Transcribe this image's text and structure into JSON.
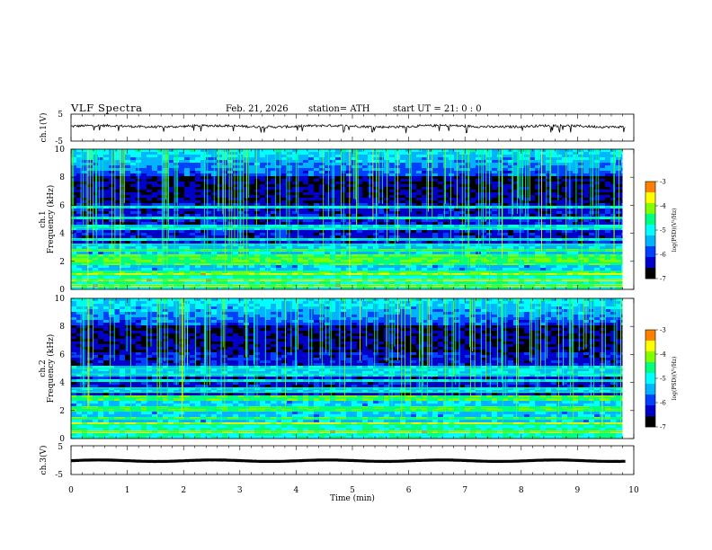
{
  "header": {
    "title": "VLF  Spectra",
    "date": "Feb. 21, 2026",
    "station": "station= ATH",
    "start_ut": "start  UT  =   21: 0   : 0"
  },
  "chart_data": [
    {
      "type": "line",
      "panel": "ch1-voltage",
      "ylabel": "ch.1(V)",
      "ylim": [
        -5,
        5
      ],
      "yticks": [
        "5",
        "-5"
      ],
      "xlim": [
        0,
        10
      ],
      "approx_level": 0.5,
      "noise_spikes": "frequent downward spikes to about -1.5 V"
    },
    {
      "type": "heatmap",
      "panel": "ch1-spectrogram",
      "ylabel_line1": "ch.1",
      "ylabel_line2": "Frequency (kHz)",
      "ylim": [
        0,
        10
      ],
      "yticks": [
        "0",
        "2",
        "4",
        "6",
        "8",
        "10"
      ],
      "xlim": [
        0,
        10
      ],
      "data_end_min": 9.8,
      "bands_khz": [
        0.3,
        0.7,
        1.0,
        1.3,
        1.9,
        2.3,
        2.8,
        3.2,
        3.6,
        4.4,
        5.1,
        5.9
      ],
      "sferic_bursts": "dense vertical impulsive lines across 0.5–10 kHz",
      "colorbar": {
        "label": "log(PSD)(V²/Hz)",
        "ticks": [
          "-3",
          "-4",
          "-5",
          "-6",
          "-7"
        ],
        "range": [
          -7,
          -3
        ]
      }
    },
    {
      "type": "heatmap",
      "panel": "ch2-spectrogram",
      "ylabel_line1": "ch.2",
      "ylabel_line2": "Frequency (kHz)",
      "ylim": [
        0,
        10
      ],
      "yticks": [
        "0",
        "2",
        "4",
        "6",
        "8",
        "10"
      ],
      "xlim": [
        0,
        10
      ],
      "data_end_min": 9.8,
      "bands_khz": [
        0.5,
        1.0,
        1.4,
        2.0,
        2.2,
        2.9,
        3.3,
        3.6,
        4.1,
        4.6,
        5.0
      ],
      "sferic_bursts": "dense vertical impulsive lines across 1–10 kHz",
      "colorbar": {
        "label": "log(PSD)(V²/Hz)",
        "ticks": [
          "-3",
          "-4",
          "-5",
          "-6",
          "-7"
        ],
        "range": [
          -7,
          -3
        ]
      }
    },
    {
      "type": "line",
      "panel": "ch3-voltage",
      "ylabel": "ch.3(V)",
      "ylim": [
        -5,
        5
      ],
      "yticks": [
        "5",
        "-5"
      ],
      "xlim": [
        0,
        10
      ],
      "approx_level": -0.2,
      "xlabel": "Time  (min)",
      "xticks": [
        "0",
        "1",
        "2",
        "3",
        "4",
        "5",
        "6",
        "7",
        "8",
        "9",
        "10"
      ]
    }
  ],
  "colors": {
    "colormap": [
      "#000000",
      "#0000c8",
      "#0040ff",
      "#00b4ff",
      "#00ffff",
      "#00ff80",
      "#80ff00",
      "#ffff00",
      "#ff8000",
      "#ff0000",
      "#ffffff"
    ],
    "trace": "#000000"
  }
}
